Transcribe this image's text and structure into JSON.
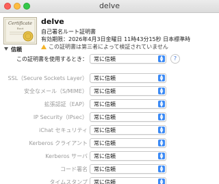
{
  "window": {
    "title": "delve"
  },
  "cert": {
    "icon_text": "Certificate",
    "icon_sub": "Root",
    "name": "delve",
    "type": "自己署名ルート証明書",
    "expiry": "有効期限：2026年4月3日金曜日 11時43分15秒 日本標準時",
    "warning": "この証明書は第三者によって検証されていません"
  },
  "trust": {
    "header": "信頼",
    "main_label": "この証明書を使用するとき：",
    "main_value": "常に信頼",
    "help": "?",
    "rows": [
      {
        "label": "SSL（Secure Sockets Layer）",
        "value": "常に信頼"
      },
      {
        "label": "安全なメール（S/MIME）",
        "value": "常に信頼"
      },
      {
        "label": "拡張認証（EAP）",
        "value": "常に信頼"
      },
      {
        "label": "IP Security（IPsec）",
        "value": "常に信頼"
      },
      {
        "label": "iChat セキュリティ",
        "value": "常に信頼"
      },
      {
        "label": "Kerberos クライアント",
        "value": "常に信頼"
      },
      {
        "label": "Kerberos サーバ",
        "value": "常に信頼"
      },
      {
        "label": "コード署名",
        "value": "常に信頼"
      },
      {
        "label": "タイムスタンプ",
        "value": "常に信頼"
      }
    ]
  },
  "colors": {
    "accent": "#3b8af5",
    "warning": "#f5b428"
  }
}
